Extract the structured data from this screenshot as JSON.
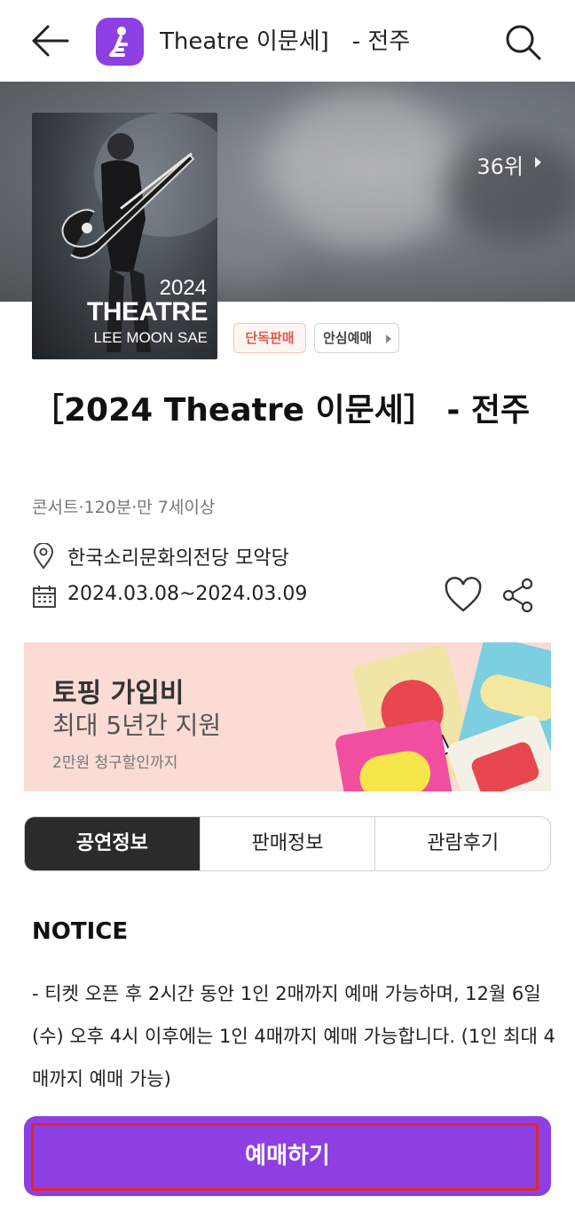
{
  "header": {
    "title": "Theatre 이문세]　- 전주",
    "back_icon": "arrow-left-icon",
    "app_icon": "app-logo-icon",
    "search_icon": "search-icon"
  },
  "hero": {
    "rank": "36위",
    "poster": {
      "year": "2024",
      "theatre": "THEATRE",
      "artist": "LEE MOON SAE"
    }
  },
  "badges": {
    "exclusive": "단독판매",
    "safe_booking": "안심예매"
  },
  "event": {
    "title": "［2024 Theatre 이문세］ - 전주",
    "meta": "콘서트·120분·만 7세이상",
    "venue": "한국소리문화의전당 모악당",
    "dates": "2024.03.08~2024.03.09"
  },
  "banner": {
    "line1": "토핑 가입비",
    "line2": "최대 5년간 지원",
    "line3": "2만원 청구할인까지"
  },
  "tabs": [
    {
      "label": "공연정보",
      "active": true
    },
    {
      "label": "판매정보",
      "active": false
    },
    {
      "label": "관람후기",
      "active": false
    }
  ],
  "notice": {
    "title": "NOTICE",
    "body": "- 티켓 오픈 후 2시간 동안 1인 2매까지 예매 가능하며, 12월 6일(수) 오후 4시 이후에는 1인 4매까지 예매 가능합니다. (1인 최대 4매까지 예매 가능)"
  },
  "book_button": "예매하기",
  "colors": {
    "brand_purple": "#8e3fe2",
    "active_tab": "#2b2b2b",
    "exclusive_badge": "#e05a47",
    "banner_bg": "#fadcd5",
    "highlight_border": "#e0262c"
  }
}
